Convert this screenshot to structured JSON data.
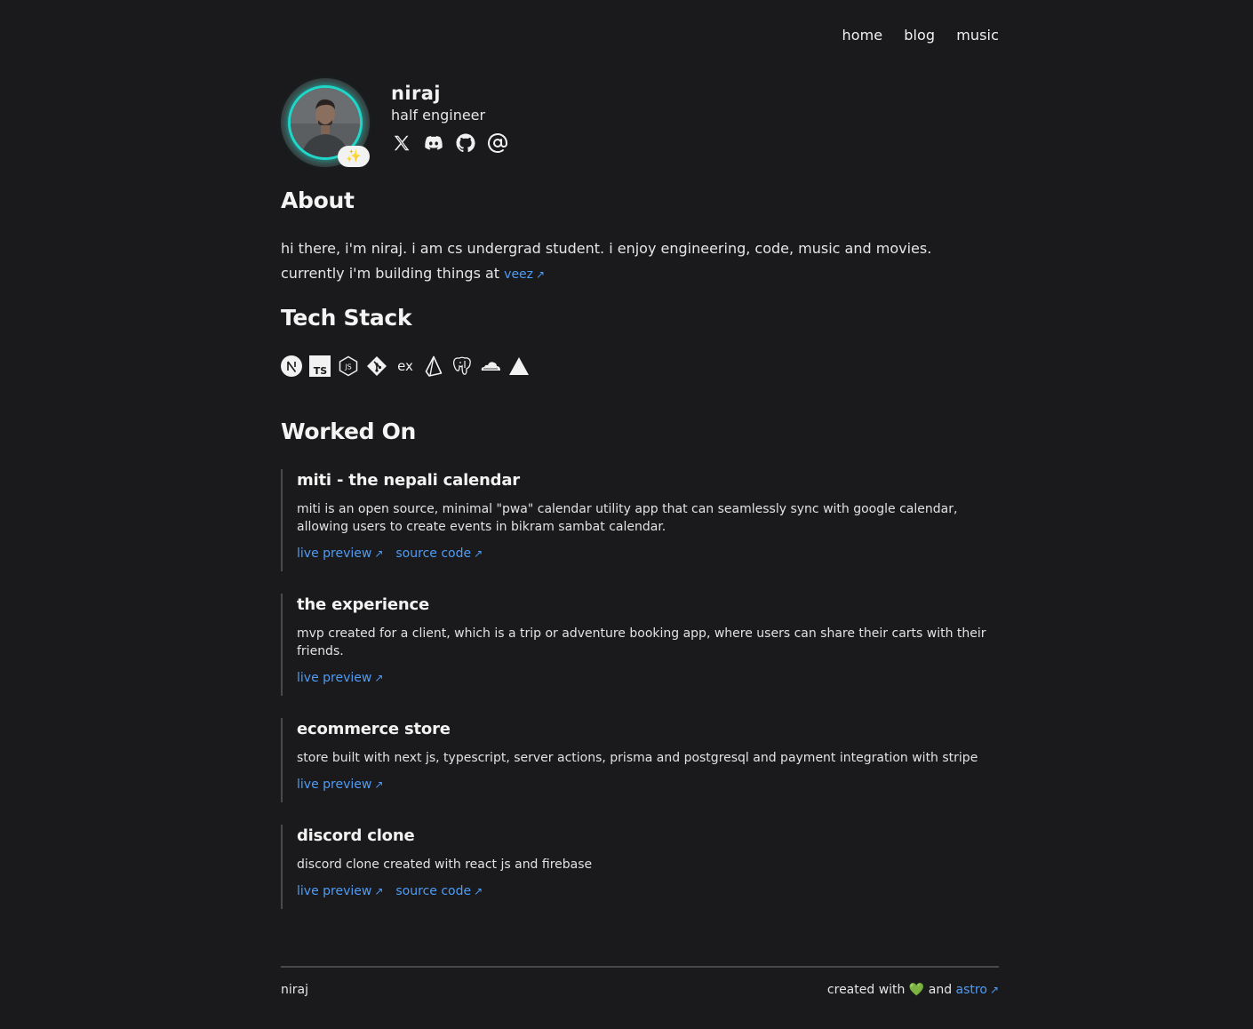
{
  "nav": {
    "items": [
      {
        "label": "home"
      },
      {
        "label": "blog"
      },
      {
        "label": "music"
      }
    ]
  },
  "profile": {
    "name": "niraj",
    "role": "half engineer",
    "badge": "✨",
    "ring_color": "#1fd6c8",
    "socials": [
      "x-icon",
      "discord-icon",
      "github-icon",
      "at-icon"
    ]
  },
  "about": {
    "heading": "About",
    "line1": "hi there, i'm niraj. i am cs undergrad student. i enjoy engineering, code, music and movies.",
    "line2": "currently i'm building things at",
    "link": "veez",
    "arrow": "↗"
  },
  "stack": {
    "heading": "Tech Stack",
    "icons": [
      "nextjs-icon",
      "typescript-icon",
      "nodejs-icon",
      "git-icon",
      "express-icon",
      "prisma-icon",
      "postgresql-icon",
      "cloudflare-icon",
      "vercel-icon"
    ]
  },
  "worked": {
    "heading": "Worked On",
    "projects": [
      {
        "title": "miti - the nepali calendar",
        "desc": "miti is an open source, minimal \"pwa\" calendar utility app that can seamlessly sync with google calendar, allowing users to create events in bikram sambat calendar.",
        "links": [
          "live preview",
          "source code"
        ]
      },
      {
        "title": "the experience",
        "desc": "mvp created for a client, which is a trip or adventure booking app, where users can share their carts with their friends.",
        "links": [
          "live preview"
        ]
      },
      {
        "title": "ecommerce store",
        "desc": "store built with next js, typescript, server actions, prisma and postgresql and payment integration with stripe",
        "links": [
          "live preview"
        ]
      },
      {
        "title": "discord clone",
        "desc": "discord clone created with react js and firebase",
        "links": [
          "live preview",
          "source code"
        ]
      }
    ]
  },
  "footer": {
    "left": "niraj",
    "created_with": "created with",
    "heart": "💚",
    "and": "and",
    "link": "astro",
    "arrow": "↗"
  },
  "colors": {
    "background": "#1a1a1c",
    "link": "#4e9cf5",
    "accent": "#1fd6c8"
  }
}
